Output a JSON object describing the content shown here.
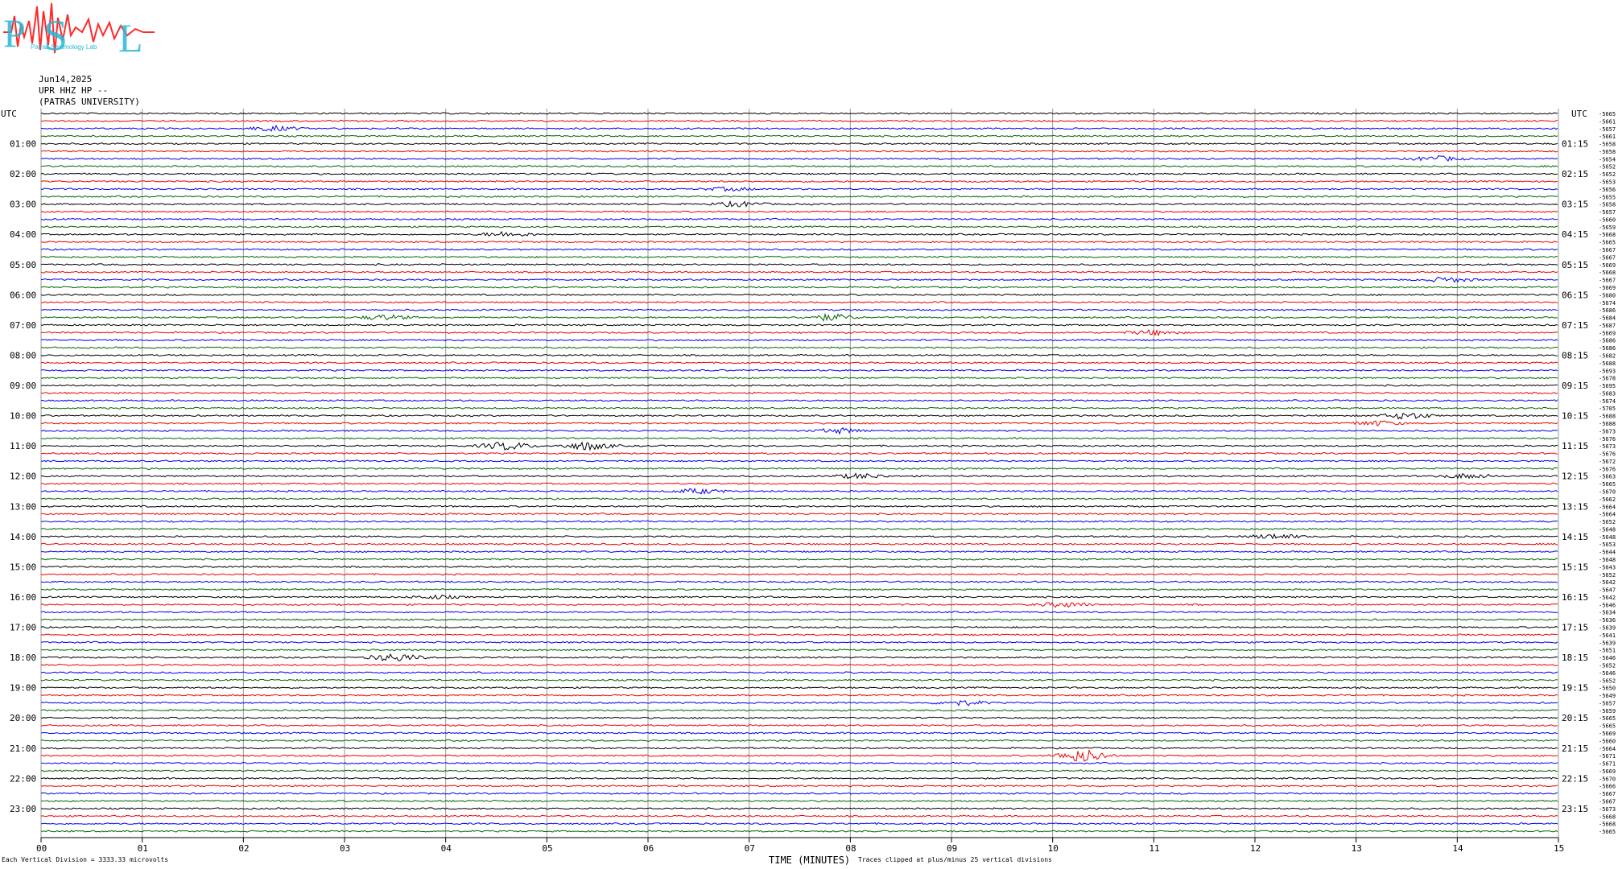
{
  "logo": {
    "letters": [
      "P",
      "S",
      "L"
    ],
    "subtext": "Patras Seismology Lab",
    "text_color": "#27b7d6",
    "wave_color": "#ff2a2a"
  },
  "header": {
    "date": "Jun14,2025",
    "station": "UPR HHZ HP --",
    "institution": "(PATRAS UNIVERSITY)"
  },
  "footer": {
    "scale_note": "Each Vertical Division = 3333.33 microvolts",
    "xlabel": "TIME (MINUTES)",
    "clip_note": "Traces clipped at plus/minus 25 vertical divisions"
  },
  "chart_data": {
    "type": "line",
    "title": "",
    "xlabel": "TIME (MINUTES)",
    "ylabel": "",
    "xlim": [
      0,
      15
    ],
    "x_ticks": [
      "00",
      "01",
      "02",
      "03",
      "04",
      "05",
      "06",
      "07",
      "08",
      "09",
      "10",
      "11",
      "12",
      "13",
      "14",
      "15"
    ],
    "grid": "vertical",
    "left_axis_labels": [
      "UTC",
      "01:00",
      "02:00",
      "03:00",
      "04:00",
      "05:00",
      "06:00",
      "07:00",
      "08:00",
      "09:00",
      "10:00",
      "11:00",
      "12:00",
      "13:00",
      "14:00",
      "15:00",
      "16:00",
      "17:00",
      "18:00",
      "19:00",
      "20:00",
      "21:00",
      "22:00",
      "23:00"
    ],
    "right_axis_labels": [
      "UTC",
      "01:15",
      "02:15",
      "03:15",
      "04:15",
      "05:15",
      "06:15",
      "07:15",
      "08:15",
      "09:15",
      "10:15",
      "11:15",
      "12:15",
      "13:15",
      "14:15",
      "15:15",
      "16:15",
      "17:15",
      "18:15",
      "19:15",
      "20:15",
      "21:15",
      "22:15",
      "23:15"
    ],
    "trace_colors": [
      "#000000",
      "#ee0000",
      "#0000ee",
      "#006400"
    ],
    "trace_count": 96,
    "trace_offsets": [
      "-5665",
      "-5661",
      "-5657",
      "-5661",
      "-5658",
      "-5658",
      "-5654",
      "-5652",
      "-5652",
      "-5653",
      "-5656",
      "-5655",
      "-5658",
      "-5657",
      "-5660",
      "-5659",
      "-5668",
      "-5665",
      "-5667",
      "-5667",
      "-5669",
      "-5668",
      "-5667",
      "-5669",
      "-5680",
      "-5674",
      "-5686",
      "-5684",
      "-5687",
      "-5669",
      "-5686",
      "-5686",
      "-5682",
      "-5688",
      "-5693",
      "-5678",
      "-5695",
      "-5683",
      "-5674",
      "-5705",
      "-5688",
      "-5688",
      "-5673",
      "-5676",
      "-5673",
      "-5676",
      "-5672",
      "-5676",
      "-5663",
      "-5665",
      "-5670",
      "-5662",
      "-5664",
      "-5664",
      "-5652",
      "-5648",
      "-5648",
      "-5653",
      "-5644",
      "-5648",
      "-5643",
      "-5652",
      "-5642",
      "-5647",
      "-5642",
      "-5646",
      "-5634",
      "-5636",
      "-5639",
      "-5641",
      "-5639",
      "-5651",
      "-5646",
      "-5652",
      "-5646",
      "-5652",
      "-5650",
      "-5649",
      "-5657",
      "-5659",
      "-5665",
      "-5665",
      "-5669",
      "-5660",
      "-5664",
      "-5671",
      "-5671",
      "-5669",
      "-5670",
      "-5666",
      "-5667",
      "-5667",
      "-5673",
      "-5668",
      "-5668",
      "-5665"
    ],
    "events": [
      {
        "trace": 2,
        "minute": 2.3,
        "amp": 3
      },
      {
        "trace": 6,
        "minute": 13.8,
        "amp": 3
      },
      {
        "trace": 10,
        "minute": 6.8,
        "amp": 2
      },
      {
        "trace": 12,
        "minute": 6.9,
        "amp": 3
      },
      {
        "trace": 16,
        "minute": 4.6,
        "amp": 3
      },
      {
        "trace": 22,
        "minute": 13.9,
        "amp": 3
      },
      {
        "trace": 27,
        "minute": 3.4,
        "amp": 3
      },
      {
        "trace": 27,
        "minute": 7.8,
        "amp": 4
      },
      {
        "trace": 29,
        "minute": 11.0,
        "amp": 3
      },
      {
        "trace": 40,
        "minute": 13.5,
        "amp": 4
      },
      {
        "trace": 41,
        "minute": 13.2,
        "amp": 3
      },
      {
        "trace": 42,
        "minute": 7.9,
        "amp": 3
      },
      {
        "trace": 44,
        "minute": 4.6,
        "amp": 5
      },
      {
        "trace": 44,
        "minute": 5.4,
        "amp": 5
      },
      {
        "trace": 48,
        "minute": 8.1,
        "amp": 3
      },
      {
        "trace": 48,
        "minute": 14.1,
        "amp": 3
      },
      {
        "trace": 50,
        "minute": 6.5,
        "amp": 3
      },
      {
        "trace": 56,
        "minute": 12.2,
        "amp": 3
      },
      {
        "trace": 64,
        "minute": 3.9,
        "amp": 2
      },
      {
        "trace": 65,
        "minute": 10.1,
        "amp": 3
      },
      {
        "trace": 72,
        "minute": 3.5,
        "amp": 5
      },
      {
        "trace": 78,
        "minute": 9.1,
        "amp": 3
      },
      {
        "trace": 85,
        "minute": 10.3,
        "amp": 8
      }
    ]
  }
}
